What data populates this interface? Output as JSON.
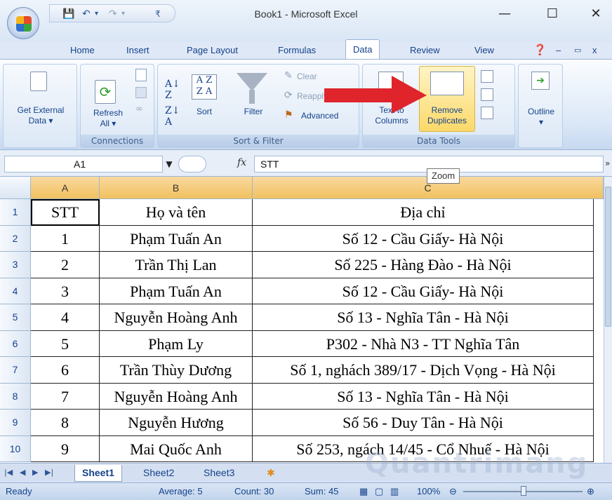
{
  "window": {
    "title": "Book1 - Microsoft Excel",
    "minimize": "—",
    "maximize": "☐",
    "close": "✕"
  },
  "tabs": [
    "Home",
    "Insert",
    "Page Layout",
    "Formulas",
    "Data",
    "Review",
    "View"
  ],
  "active_tab": "Data",
  "ribbon": {
    "get_external": {
      "line1": "Get External",
      "line2": "Data ▾"
    },
    "refresh": {
      "line1": "Refresh",
      "line2": "All ▾"
    },
    "connections_label": "Connections",
    "sort_az": "A↓Z",
    "sort_label": "Sort",
    "filter_label": "Filter",
    "clear_label": "Clear",
    "reapply_label": "Reapply",
    "advanced_label": "Advanced",
    "sort_filter_label": "Sort & Filter",
    "text_to_columns": {
      "line1": "Text to",
      "line2": "Columns"
    },
    "remove_duplicates": {
      "line1": "Remove",
      "line2": "Duplicates"
    },
    "data_tools_label": "Data Tools",
    "outline": {
      "line1": "Outline",
      "line2": "▾"
    }
  },
  "formula_bar": {
    "name_box": "A1",
    "fx": "fx",
    "formula": "STT"
  },
  "tooltip": "Zoom",
  "columns": [
    "A",
    "B",
    "C"
  ],
  "rows": [
    {
      "n": "1",
      "stt": "STT",
      "name": "Họ và tên",
      "addr": "Địa chỉ"
    },
    {
      "n": "2",
      "stt": "1",
      "name": "Phạm Tuấn An",
      "addr": "Số 12 - Cầu Giấy- Hà Nội"
    },
    {
      "n": "3",
      "stt": "2",
      "name": "Trần Thị Lan",
      "addr": "Số 225 - Hàng Đào - Hà Nội"
    },
    {
      "n": "4",
      "stt": "3",
      "name": "Phạm Tuấn An",
      "addr": "Số 12 - Cầu Giấy- Hà Nội"
    },
    {
      "n": "5",
      "stt": "4",
      "name": "Nguyễn Hoàng Anh",
      "addr": "Số 13 - Nghĩa Tân - Hà Nội"
    },
    {
      "n": "6",
      "stt": "5",
      "name": "Phạm Ly",
      "addr": "P302 - Nhà N3 - TT Nghĩa Tân"
    },
    {
      "n": "7",
      "stt": "6",
      "name": "Trần Thùy Dương",
      "addr": "Số 1, nghách 389/17 - Dịch Vọng - Hà Nội"
    },
    {
      "n": "8",
      "stt": "7",
      "name": "Nguyễn Hoàng Anh",
      "addr": "Số 13 - Nghĩa Tân - Hà Nội"
    },
    {
      "n": "9",
      "stt": "8",
      "name": "Nguyễn Hương",
      "addr": "Số 56 - Duy Tân - Hà Nội"
    },
    {
      "n": "10",
      "stt": "9",
      "name": "Mai Quốc Anh",
      "addr": "Số 253, ngách 14/45 - Cổ Nhuế - Hà Nội"
    }
  ],
  "sheets": [
    "Sheet1",
    "Sheet2",
    "Sheet3"
  ],
  "status": {
    "ready": "Ready",
    "average": "Average: 5",
    "count": "Count: 30",
    "sum": "Sum: 45",
    "zoom": "100%"
  },
  "colors": {
    "accent_arrow": "#e0242c",
    "selected_button": "#fbd96a"
  }
}
